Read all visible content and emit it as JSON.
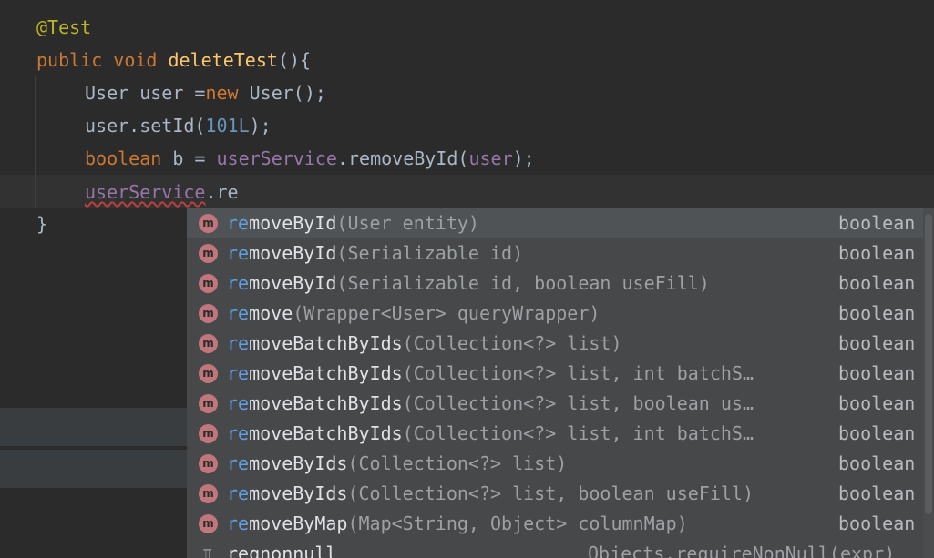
{
  "editor": {
    "lines": [
      {
        "tokens": [
          {
            "text": "@Test",
            "cls": "ann"
          }
        ]
      },
      {
        "tokens": [
          {
            "text": "public",
            "cls": "kw"
          },
          {
            "text": " ",
            "cls": "plain"
          },
          {
            "text": "void",
            "cls": "kw"
          },
          {
            "text": " ",
            "cls": "plain"
          },
          {
            "text": "deleteTest",
            "cls": "fn"
          },
          {
            "text": "(){",
            "cls": "plain"
          }
        ]
      },
      {
        "tokens": [
          {
            "text": "User",
            "cls": "plain"
          },
          {
            "text": " user =",
            "cls": "plain"
          },
          {
            "text": "new",
            "cls": "kw"
          },
          {
            "text": " User();",
            "cls": "plain"
          }
        ]
      },
      {
        "tokens": [
          {
            "text": "user.setId(",
            "cls": "plain"
          },
          {
            "text": "101L",
            "cls": "num"
          },
          {
            "text": ");",
            "cls": "plain"
          }
        ]
      },
      {
        "tokens": [
          {
            "text": "boolean",
            "cls": "kw"
          },
          {
            "text": " b = ",
            "cls": "plain"
          },
          {
            "text": "userService",
            "cls": "var"
          },
          {
            "text": ".removeById(",
            "cls": "plain"
          },
          {
            "text": "user",
            "cls": "var"
          },
          {
            "text": ");",
            "cls": "plain"
          }
        ]
      },
      {
        "tokens": [
          {
            "text": "userService",
            "cls": "var err"
          },
          {
            "text": ".re",
            "cls": "plain"
          }
        ]
      },
      {
        "tokens": [
          {
            "text": "}",
            "cls": "plain"
          }
        ]
      }
    ]
  },
  "completion": {
    "icon_letter": "m",
    "items": [
      {
        "match": "re",
        "rest": "moveById",
        "params": "(User entity)",
        "type": "boolean"
      },
      {
        "match": "re",
        "rest": "moveById",
        "params": "(Serializable id)",
        "type": "boolean"
      },
      {
        "match": "re",
        "rest": "moveById",
        "params": "(Serializable id, boolean useFill)",
        "type": "boolean"
      },
      {
        "match": "re",
        "rest": "move",
        "params": "(Wrapper<User> queryWrapper)",
        "type": "boolean"
      },
      {
        "match": "re",
        "rest": "moveBatchByIds",
        "params": "(Collection<?> list)",
        "type": "boolean"
      },
      {
        "match": "re",
        "rest": "moveBatchByIds",
        "params": "(Collection<?> list, int batchS…",
        "type": "boolean"
      },
      {
        "match": "re",
        "rest": "moveBatchByIds",
        "params": "(Collection<?> list, boolean us…",
        "type": "boolean"
      },
      {
        "match": "re",
        "rest": "moveBatchByIds",
        "params": "(Collection<?> list, int batchS…",
        "type": "boolean"
      },
      {
        "match": "re",
        "rest": "moveByIds",
        "params": "(Collection<?> list)",
        "type": "boolean"
      },
      {
        "match": "re",
        "rest": "moveByIds",
        "params": "(Collection<?> list, boolean useFill)",
        "type": "boolean"
      },
      {
        "match": "re",
        "rest": "moveByMap",
        "params": "(Map<String, Object> columnMap)",
        "type": "boolean"
      }
    ],
    "postfix": {
      "name": "reqnonnull",
      "hint": "Objects.requireNonNull(expr)"
    }
  },
  "colors": {
    "background": "#2b2b2b",
    "popup": "#46484a",
    "match_highlight": "#5f9fe3",
    "method_icon": "#c1767b",
    "keyword": "#cc7832"
  }
}
